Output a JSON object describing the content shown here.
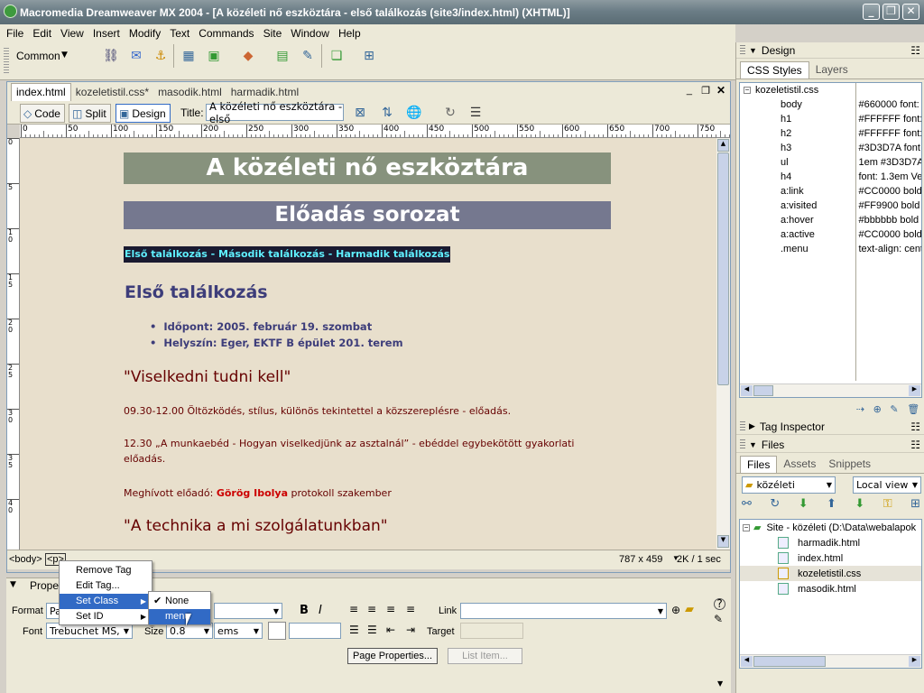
{
  "window": {
    "title": "Macromedia Dreamweaver MX 2004 - [A közéleti nő eszköztára - első találkozás (site3/index.html) (XHTML)]"
  },
  "menubar": [
    "File",
    "Edit",
    "View",
    "Insert",
    "Modify",
    "Text",
    "Commands",
    "Site",
    "Window",
    "Help"
  ],
  "insert_bar": {
    "category": "Common"
  },
  "doc_tabs": [
    "index.html",
    "kozeletistil.css*",
    "masodik.html",
    "harmadik.html"
  ],
  "doc_toolbar": {
    "code": "Code",
    "split": "Split",
    "design": "Design",
    "title_label": "Title:",
    "title_value": "A közéleti nő eszköztára - első"
  },
  "ruler": {
    "h_ticks": [
      "0",
      "50",
      "100",
      "150",
      "200",
      "250",
      "300",
      "350",
      "400",
      "450",
      "500",
      "550",
      "600",
      "650",
      "700",
      "750"
    ],
    "v_ticks": [
      "0",
      "5",
      "1 0",
      "1 5",
      "2 0",
      "2 5",
      "3 0",
      "3 5",
      "4 0"
    ]
  },
  "page": {
    "h1": "A közéleti nő eszköztára",
    "h2": "Előadás sorozat",
    "menu": "Első találkozás - Második találkozás - Harmadik találkozás",
    "h3": "Első találkozás",
    "list": [
      "Időpont: 2005. február 19. szombat",
      "Helyszín: Eger, EKTF B épület 201. terem"
    ],
    "h4a": "\"Viselkedni tudni kell\"",
    "p1": "09.30-12.00 Öltözködés, stílus, különös tekintettel a közszereplésre - előadás.",
    "p2a": "12.30 „A munkaebéd - Hogyan viselkedjünk az asztalnál” - ebéddel egybekötött gyakorlati",
    "p2b": "előadás.",
    "p3_label": "Meghívott előadó:",
    "p3_name": "Görög Ibolya",
    "p3_rest": "protokoll szakember",
    "h4b": "\"A technika a mi szolgálatunkban\""
  },
  "status": {
    "tag_body": "<body>",
    "tag_p": "<p>",
    "size": "787 x 459",
    "weight": "2K / 1 sec"
  },
  "props": {
    "header": "Proper",
    "format_label": "Format",
    "format_value": "Pa",
    "font_label": "Font",
    "font_value": "Trebuchet MS,",
    "size_label": "Size",
    "size_value": "0.8",
    "units": "ems",
    "link_label": "Link",
    "target_label": "Target",
    "page_props": "Page Properties...",
    "list_item": "List Item..."
  },
  "context_menu": {
    "items": [
      "Remove Tag",
      "Edit Tag...",
      "Set Class",
      "Set ID"
    ],
    "submenu": [
      "None",
      "menu"
    ]
  },
  "panels": {
    "design": "Design",
    "css_tabs": [
      "CSS Styles",
      "Layers"
    ],
    "stylesheet": "kozeletistil.css",
    "rules": [
      {
        "sel": "body",
        "val": "#660000 font:"
      },
      {
        "sel": "h1",
        "val": "#FFFFFF font:"
      },
      {
        "sel": "h2",
        "val": "#FFFFFF font:"
      },
      {
        "sel": "h3",
        "val": "#3D3D7A font:"
      },
      {
        "sel": "ul",
        "val": "1em #3D3D7A"
      },
      {
        "sel": "h4",
        "val": "font: 1.3em Ver"
      },
      {
        "sel": "a:link",
        "val": "#CC0000 bold n"
      },
      {
        "sel": "a:visited",
        "val": "#FF9900 bold n"
      },
      {
        "sel": "a:hover",
        "val": "#bbbbbb bold u"
      },
      {
        "sel": "a:active",
        "val": "#CC0000 bold n"
      },
      {
        "sel": ".menu",
        "val": "text-align: cent"
      }
    ],
    "tag_inspector": "Tag Inspector",
    "files": "Files",
    "file_tabs": [
      "Files",
      "Assets",
      "Snippets"
    ],
    "site_select": "közéleti",
    "view_select": "Local view",
    "site_root": "Site - közéleti (D:\\Data\\webalapok",
    "files_list": [
      "harmadik.html",
      "index.html",
      "kozeletistil.css",
      "masodik.html"
    ]
  }
}
